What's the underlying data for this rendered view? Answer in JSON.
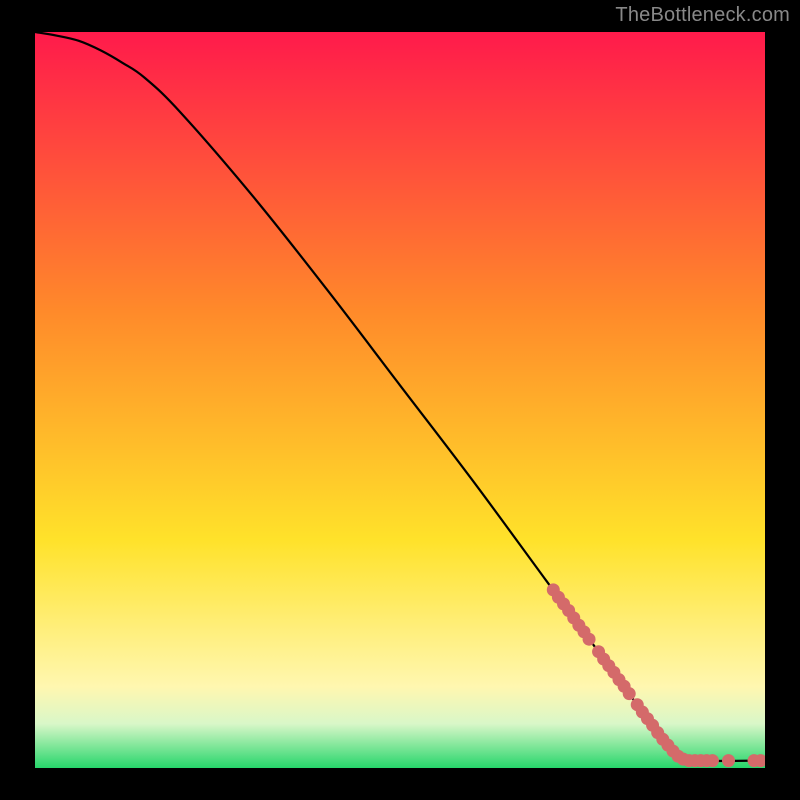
{
  "attribution": "TheBottleneck.com",
  "colors": {
    "gradient_top": "#ff1a4b",
    "gradient_mid1": "#ff8a2a",
    "gradient_mid2": "#ffe22a",
    "gradient_low": "#fff7b0",
    "gradient_green_top": "#d9f7c8",
    "gradient_green_bot": "#27d66b",
    "line": "#000000",
    "marker": "#d46a6a"
  },
  "chart_data": {
    "type": "line",
    "title": "",
    "xlabel": "",
    "ylabel": "",
    "xlim": [
      0,
      100
    ],
    "ylim": [
      0,
      100
    ],
    "grid": false,
    "legend": false,
    "line_series": {
      "name": "bottleneck-curve",
      "points": [
        {
          "x": 0,
          "y": 100
        },
        {
          "x": 3,
          "y": 99.5
        },
        {
          "x": 6,
          "y": 98.8
        },
        {
          "x": 9,
          "y": 97.5
        },
        {
          "x": 12,
          "y": 95.8
        },
        {
          "x": 15,
          "y": 93.8
        },
        {
          "x": 20,
          "y": 89.0
        },
        {
          "x": 30,
          "y": 77.5
        },
        {
          "x": 40,
          "y": 65.0
        },
        {
          "x": 50,
          "y": 52.0
        },
        {
          "x": 60,
          "y": 39.0
        },
        {
          "x": 70,
          "y": 25.5
        },
        {
          "x": 80,
          "y": 12.0
        },
        {
          "x": 84,
          "y": 6.5
        },
        {
          "x": 87,
          "y": 2.8
        },
        {
          "x": 88,
          "y": 1.6
        },
        {
          "x": 89,
          "y": 1.0
        },
        {
          "x": 100,
          "y": 1.0
        }
      ]
    },
    "marker_series": {
      "name": "highlighted-points",
      "points": [
        {
          "x": 71.0,
          "y": 24.2
        },
        {
          "x": 71.7,
          "y": 23.2
        },
        {
          "x": 72.4,
          "y": 22.3
        },
        {
          "x": 73.1,
          "y": 21.4
        },
        {
          "x": 73.8,
          "y": 20.4
        },
        {
          "x": 74.5,
          "y": 19.4
        },
        {
          "x": 75.2,
          "y": 18.5
        },
        {
          "x": 75.9,
          "y": 17.5
        },
        {
          "x": 77.2,
          "y": 15.8
        },
        {
          "x": 77.9,
          "y": 14.8
        },
        {
          "x": 78.6,
          "y": 13.9
        },
        {
          "x": 79.3,
          "y": 13.0
        },
        {
          "x": 80.0,
          "y": 12.0
        },
        {
          "x": 80.7,
          "y": 11.1
        },
        {
          "x": 81.4,
          "y": 10.1
        },
        {
          "x": 82.5,
          "y": 8.6
        },
        {
          "x": 83.2,
          "y": 7.6
        },
        {
          "x": 83.9,
          "y": 6.7
        },
        {
          "x": 84.6,
          "y": 5.8
        },
        {
          "x": 85.3,
          "y": 4.8
        },
        {
          "x": 86.0,
          "y": 3.9
        },
        {
          "x": 86.7,
          "y": 3.1
        },
        {
          "x": 87.4,
          "y": 2.3
        },
        {
          "x": 88.1,
          "y": 1.6
        },
        {
          "x": 88.8,
          "y": 1.2
        },
        {
          "x": 89.6,
          "y": 1.0
        },
        {
          "x": 90.4,
          "y": 1.0
        },
        {
          "x": 91.2,
          "y": 1.0
        },
        {
          "x": 92.0,
          "y": 1.0
        },
        {
          "x": 92.8,
          "y": 1.0
        },
        {
          "x": 95.0,
          "y": 1.0
        },
        {
          "x": 98.5,
          "y": 1.0
        },
        {
          "x": 99.4,
          "y": 1.0
        }
      ]
    }
  }
}
